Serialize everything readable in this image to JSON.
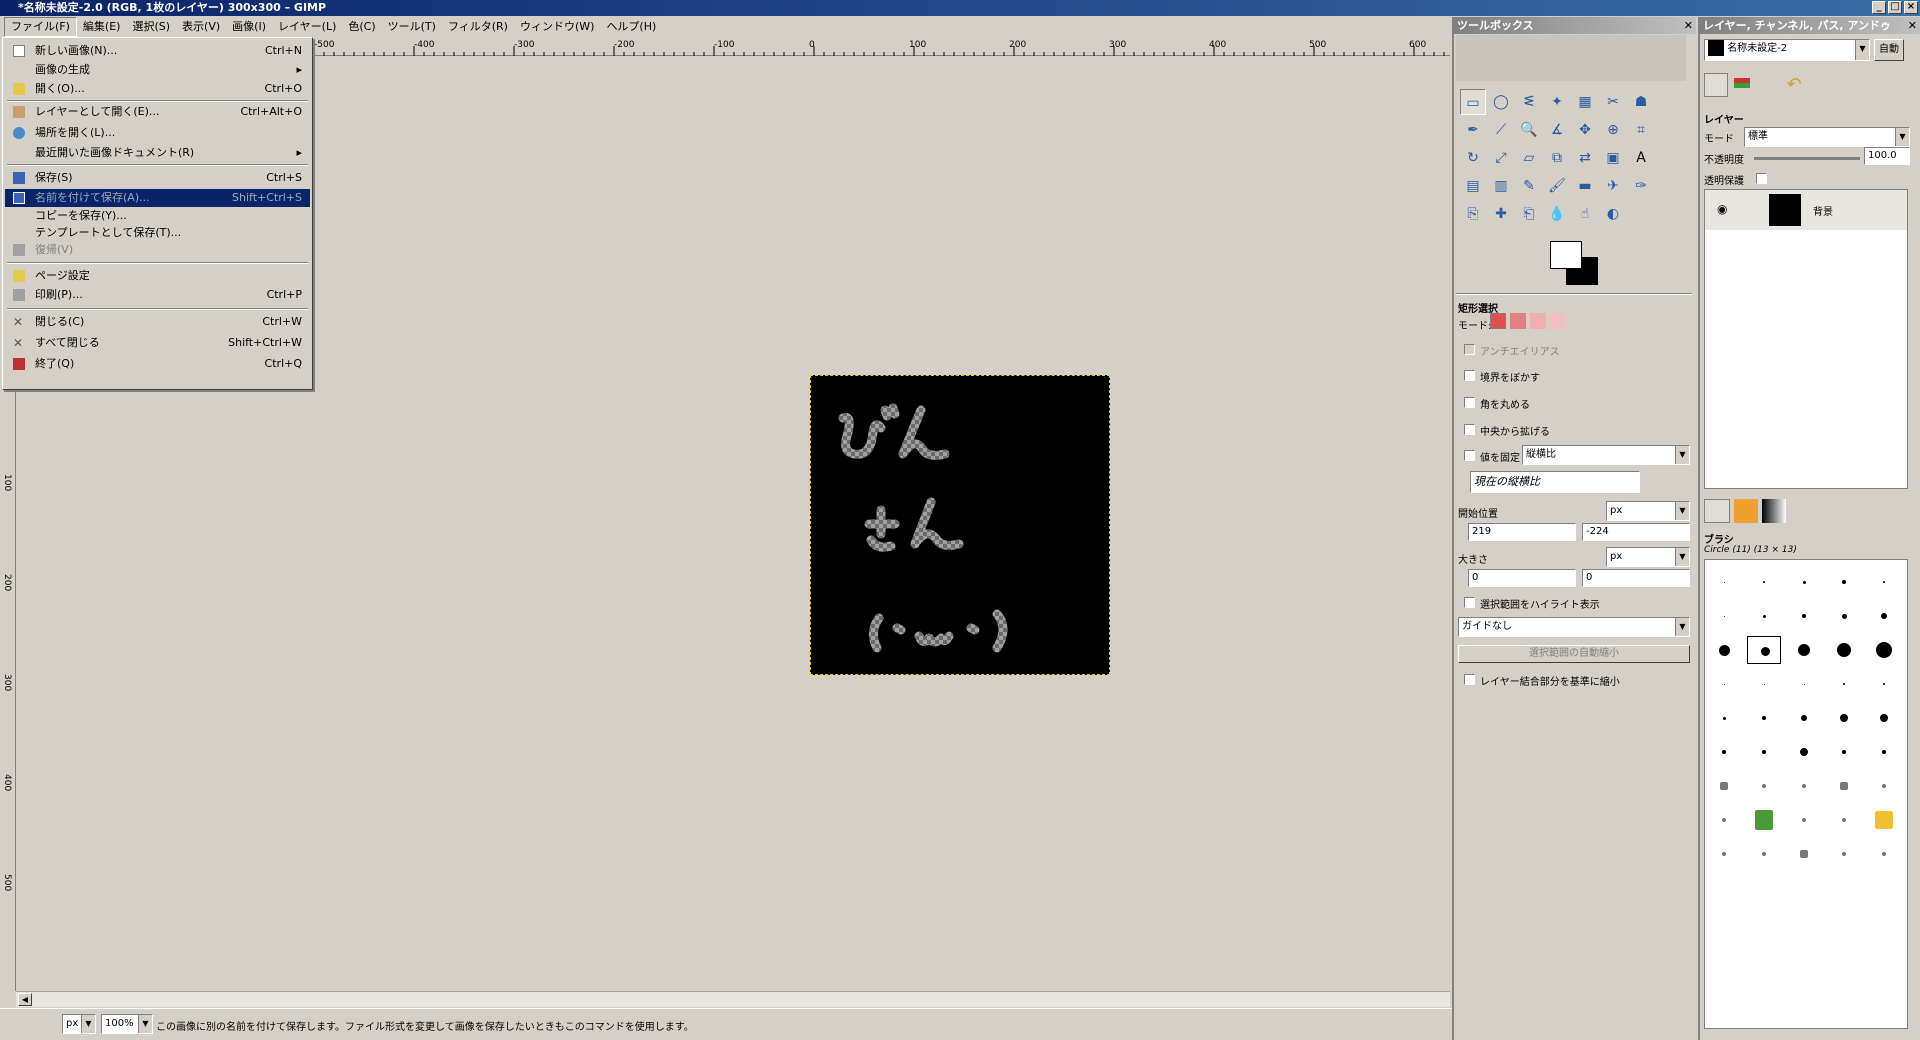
{
  "window": {
    "title": "*名称未設定-2.0 (RGB, 1枚のレイヤー) 300x300 – GIMP"
  },
  "menubar": {
    "items": [
      "ファイル(F)",
      "編集(E)",
      "選択(S)",
      "表示(V)",
      "画像(I)",
      "レイヤー(L)",
      "色(C)",
      "ツール(T)",
      "フィルタ(R)",
      "ウィンドウ(W)",
      "ヘルプ(H)"
    ]
  },
  "file_menu": {
    "items": [
      {
        "label": "新しい画像(N)...",
        "shortcut": "Ctrl+N"
      },
      {
        "label": "画像の生成",
        "shortcut": "▸"
      },
      {
        "label": "開く(O)...",
        "shortcut": "Ctrl+O"
      },
      {
        "label": "レイヤーとして開く(E)...",
        "shortcut": "Ctrl+Alt+O"
      },
      {
        "label": "場所を開く(L)...",
        "shortcut": ""
      },
      {
        "label": "最近開いた画像ドキュメント(R)",
        "shortcut": "▸"
      },
      {
        "label": "保存(S)",
        "shortcut": "Ctrl+S"
      },
      {
        "label": "名前を付けて保存(A)...",
        "shortcut": "Shift+Ctrl+S"
      },
      {
        "label": "コピーを保存(Y)...",
        "shortcut": ""
      },
      {
        "label": "テンプレートとして保存(T)...",
        "shortcut": ""
      },
      {
        "label": "復帰(V)",
        "shortcut": ""
      },
      {
        "label": "ページ設定",
        "shortcut": ""
      },
      {
        "label": "印刷(P)...",
        "shortcut": "Ctrl+P"
      },
      {
        "label": "閉じる(C)",
        "shortcut": "Ctrl+W"
      },
      {
        "label": "すべて閉じる",
        "shortcut": "Shift+Ctrl+W"
      },
      {
        "label": "終了(Q)",
        "shortcut": "Ctrl+Q"
      }
    ]
  },
  "ruler": {
    "top_labels": [
      "-500",
      "-400",
      "-300",
      "-200",
      "-100",
      "0",
      "100",
      "200",
      "300",
      "400",
      "500",
      "600"
    ],
    "left_labels": [
      "100",
      "200",
      "300",
      "400",
      "500"
    ]
  },
  "status": {
    "unit": "px",
    "zoom": "100%",
    "message": "この画像に別の名前を付けて保存します。ファイル形式を変更して画像を保存したいときもこのコマンドを使用します。"
  },
  "toolbox": {
    "title": "ツールボックス",
    "options_title": "矩形選択",
    "mode_label": "モード:",
    "antialias": "アンチエイリアス",
    "feather": "境界をぼかす",
    "rounded": "角を丸める",
    "expand_center": "中央から拡げる",
    "fixed": "値を固定",
    "fixed_value": "縦横比",
    "current_ratio": "現在の縦横比",
    "position_label": "開始位置",
    "position_unit": "px",
    "pos_x": "219",
    "pos_y": "-224",
    "size_label": "大きさ",
    "size_unit": "px",
    "size_x": "0",
    "size_y": "0",
    "highlight": "選択範囲をハイライト表示",
    "guides": "ガイドなし",
    "auto_shrink": "選択範囲の自動縮小",
    "shrink_merged": "レイヤー結合部分を基準に縮小"
  },
  "layers": {
    "title": "レイヤー, チャンネル, パス, アンドゥ",
    "image_select": "名称未設定-2",
    "auto_button": "自動",
    "section": "レイヤー",
    "mode_label": "モード",
    "mode_value": "標準",
    "opacity_label": "不透明度",
    "opacity_value": "100.0",
    "lock_label": "透明保護",
    "layer_name": "背景"
  },
  "brushes": {
    "title": "ブラシ",
    "selected": "Circle (11) (13 × 13)"
  },
  "image_text": [
    "ぴん",
    "さん",
    "( ˙ω˙ )"
  ]
}
